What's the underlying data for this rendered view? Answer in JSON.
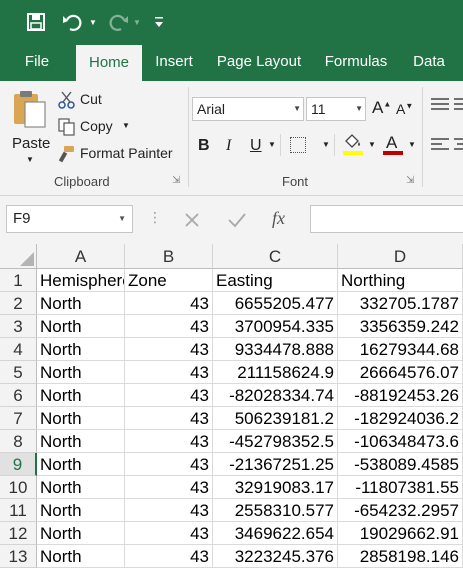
{
  "tabs": [
    "File",
    "Home",
    "Insert",
    "Page Layout",
    "Formulas",
    "Data"
  ],
  "active_tab": "Home",
  "clipboard": {
    "paste_label": "Paste",
    "cut_label": "Cut",
    "copy_label": "Copy",
    "format_painter_label": "Format Painter",
    "group_label": "Clipboard"
  },
  "font": {
    "font_name": "Arial",
    "font_size": "11",
    "bold": "B",
    "italic": "I",
    "underline": "U",
    "font_color_letter": "A",
    "group_label": "Font",
    "highlight_color": "#ffff00",
    "text_color": "#c00000"
  },
  "formula_bar": {
    "name_box": "F9",
    "fx": "fx",
    "value": ""
  },
  "accent_color": "#217346",
  "columns": [
    "A",
    "B",
    "C",
    "D"
  ],
  "selected_row": "9",
  "rows": [
    {
      "num": "1",
      "cells": [
        "Hemisphere",
        "Zone",
        "Easting",
        "Northing"
      ]
    },
    {
      "num": "2",
      "cells": [
        "North",
        "43",
        "6655205.477",
        "332705.1787"
      ]
    },
    {
      "num": "3",
      "cells": [
        "North",
        "43",
        "3700954.335",
        "3356359.242"
      ]
    },
    {
      "num": "4",
      "cells": [
        "North",
        "43",
        "9334478.888",
        "16279344.68"
      ]
    },
    {
      "num": "5",
      "cells": [
        "North",
        "43",
        "211158624.9",
        "26664576.07"
      ]
    },
    {
      "num": "6",
      "cells": [
        "North",
        "43",
        "-82028334.74",
        "-88192453.26"
      ]
    },
    {
      "num": "7",
      "cells": [
        "North",
        "43",
        "506239181.2",
        "-182924036.2"
      ]
    },
    {
      "num": "8",
      "cells": [
        "North",
        "43",
        "-452798352.5",
        "-106348473.6"
      ]
    },
    {
      "num": "9",
      "cells": [
        "North",
        "43",
        "-21367251.25",
        "-538089.4585"
      ]
    },
    {
      "num": "10",
      "cells": [
        "North",
        "43",
        "32919083.17",
        "-11807381.55"
      ]
    },
    {
      "num": "11",
      "cells": [
        "North",
        "43",
        "2558310.577",
        "-654232.2957"
      ]
    },
    {
      "num": "12",
      "cells": [
        "North",
        "43",
        "3469622.654",
        "19029662.91"
      ]
    },
    {
      "num": "13",
      "cells": [
        "North",
        "43",
        "3223245.376",
        "2858198.146"
      ]
    }
  ]
}
